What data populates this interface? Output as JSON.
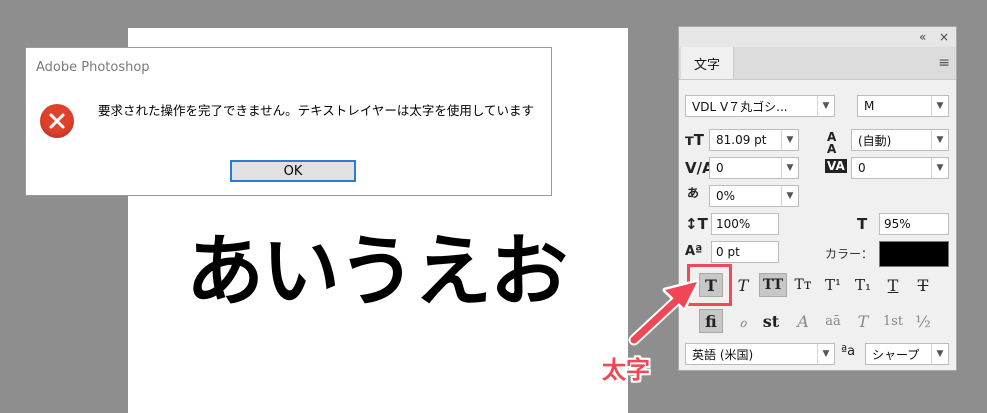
{
  "canvas": {
    "text": "あいうえお"
  },
  "dialog": {
    "title": "Adobe Photoshop",
    "message": "要求された操作を完了できません。テキストレイヤーは太字を使用しています",
    "ok_label": "OK"
  },
  "panel": {
    "collapse_label": "«",
    "close_label": "×",
    "tab": "文字",
    "menu_label": "≡",
    "font_family": "VDL V７丸ゴシ...",
    "font_style": "M",
    "font_size": "81.09 pt",
    "leading": "(自動)",
    "kerning": "0",
    "tracking": "0",
    "tsume": "0%",
    "vertical_scale": "100%",
    "horizontal_scale": "95%",
    "baseline_shift": "0 pt",
    "color_label": "カラー：",
    "language": "英語 (米国)",
    "antialias": "シャープ"
  },
  "style_row1": [
    "T",
    "T",
    "TT",
    "Tт",
    "T¹",
    "T₁",
    "T",
    "T"
  ],
  "style_row2": [
    "fi",
    "ℴ",
    "st",
    "A",
    "aā",
    "T",
    "1st",
    "½"
  ],
  "annotation": {
    "label": "太字",
    "color": "#f04656"
  }
}
